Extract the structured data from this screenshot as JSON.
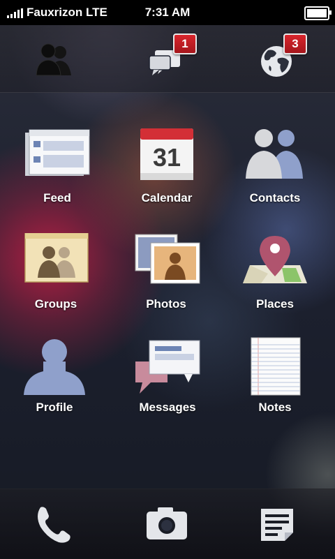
{
  "status_bar": {
    "carrier": "Fauxrizon LTE",
    "time": "7:31 AM"
  },
  "top_bar": {
    "friends_icon": "friend-requests-icon",
    "messages_badge": "1",
    "notifications_badge": "3"
  },
  "apps": [
    {
      "label": "Feed",
      "icon": "feed-icon"
    },
    {
      "label": "Calendar",
      "icon": "calendar-icon",
      "date": "31"
    },
    {
      "label": "Contacts",
      "icon": "contacts-icon"
    },
    {
      "label": "Groups",
      "icon": "groups-icon"
    },
    {
      "label": "Photos",
      "icon": "photos-icon"
    },
    {
      "label": "Places",
      "icon": "places-icon"
    },
    {
      "label": "Profile",
      "icon": "profile-icon"
    },
    {
      "label": "Messages",
      "icon": "messages-icon"
    },
    {
      "label": "Notes",
      "icon": "notes-icon"
    }
  ],
  "dock": [
    "phone-icon",
    "camera-icon",
    "compose-icon"
  ],
  "colors": {
    "badge_red": "#c41e25",
    "calendar_red": "#d32f36",
    "profile_blue": "#8fa0cb"
  }
}
